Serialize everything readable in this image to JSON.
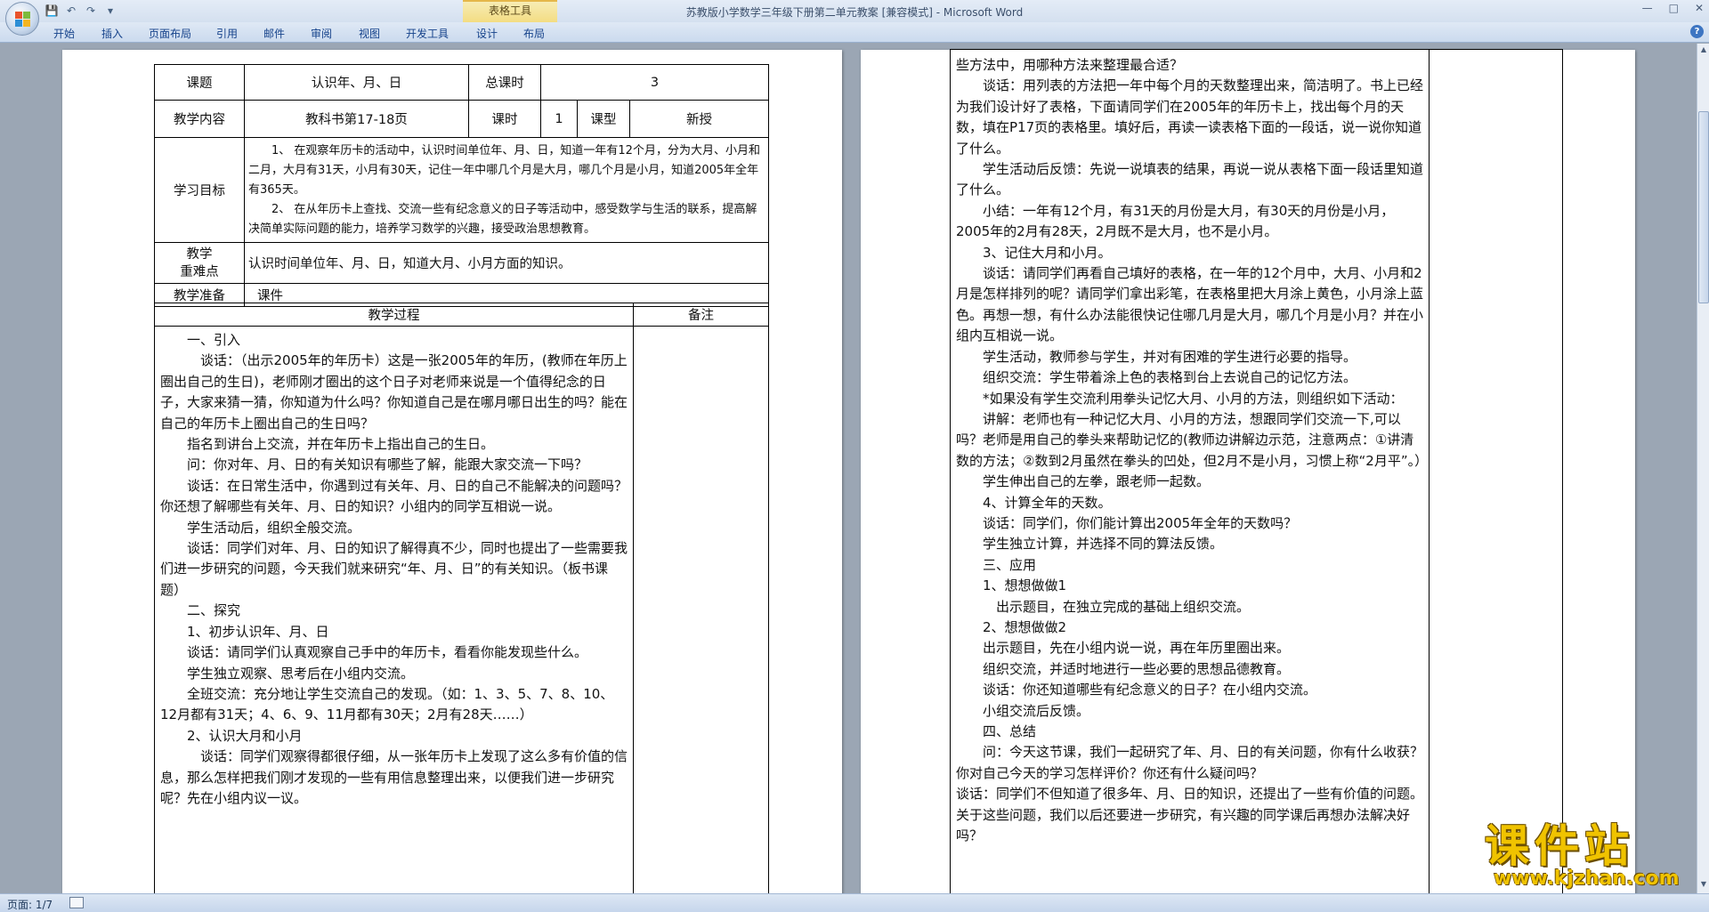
{
  "window": {
    "title": "苏教版小学数学三年级下册第二单元教案 [兼容模式] - Microsoft Word",
    "context_tab": "表格工具",
    "controls": [
      "—",
      "□",
      "✕"
    ]
  },
  "ribbon": {
    "tabs": [
      "开始",
      "插入",
      "页面布局",
      "引用",
      "邮件",
      "审阅",
      "视图",
      "开发工具",
      "设计",
      "布局"
    ]
  },
  "status": {
    "pages": "页面: 1/7"
  },
  "watermark": {
    "main": "课件站",
    "url": "www.kjzhan.com"
  },
  "page1": {
    "row1": {
      "topic_label": "课题",
      "topic": "认识年、月、日",
      "total_label": "总课时",
      "total": "3"
    },
    "row2": {
      "content_label": "教学内容",
      "content": "教科书第17-18页",
      "hours_label": "课时",
      "hours": "1",
      "type_label": "课型",
      "type": "新授"
    },
    "goals": {
      "label": "学习目标",
      "items": [
        "1、 在观察年历卡的活动中，认识时间单位年、月、日，知道一年有12个月，分为大月、小月和二月，大月有31天，小月有30天，记住一年中哪几个月是大月，哪几个月是小月，知道2005年全年有365天。",
        "2、 在从年历卡上查找、交流一些有纪念意义的日子等活动中，感受数学与生活的联系，提高解决简单实际问题的能力，培养学习数学的兴趣，接受政治思想教育。"
      ]
    },
    "key_points": {
      "label_1": "教学",
      "label_2": "重难点",
      "text": "认识时间单位年、月、日，知道大月、小月方面的知识。"
    },
    "prep": {
      "label": "教学准备",
      "text": "课件"
    },
    "process_header": "教学过程",
    "notes_header": "备注",
    "process": [
      "一、引入",
      "谈话：（出示2005年的年历卡）这是一张2005年的年历，(教师在年历上圈出自己的生日)，老师刚才圈出的这个日子对老师来说是一个值得纪念的日子，大家来猜一猜，你知道为什么吗？你知道自己是在哪月哪日出生的吗？能在自己的年历卡上圈出自己的生日吗？",
      "指名到讲台上交流，并在年历卡上指出自己的生日。",
      "问：你对年、月、日的有关知识有哪些了解，能跟大家交流一下吗？",
      "谈话：在日常生活中，你遇到过有关年、月、日的自己不能解决的问题吗？你还想了解哪些有关年、月、日的知识？小组内的同学互相说一说。",
      "学生活动后，组织全般交流。",
      "谈话：同学们对年、月、日的知识了解得真不少，同时也提出了一些需要我们进一步研究的问题，今天我们就来研究“年、月、日”的有关知识。（板书课题）",
      "二、探究",
      "1、初步认识年、月、日",
      "谈话：请同学们认真观察自己手中的年历卡，看看你能发现些什么。",
      "学生独立观察、思考后在小组内交流。",
      "全班交流：充分地让学生交流自己的发现。（如：1、3、5、7、8、10、12月都有31天；4、6、9、11月都有30天；2月有28天……）",
      "2、认识大月和小月",
      "谈话：同学们观察得都很仔细，从一张年历卡上发现了这么多有价值的信息，那么怎样把我们刚才发现的一些有用信息整理出来，以便我们进一步研究呢？先在小组内议一议。"
    ]
  },
  "page2": {
    "process": [
      "些方法中，用哪种方法来整理最合适？",
      "谈话：用列表的方法把一年中每个月的天数整理出来，简洁明了。书上已经为我们设计好了表格，下面请同学们在2005年的年历卡上，找出每个月的天数，填在P17页的表格里。填好后，再读一读表格下面的一段话，说一说你知道了什么。",
      "学生活动后反馈：先说一说填表的结果，再说一说从表格下面一段话里知道了什么。",
      "小结：一年有12个月，有31天的月份是大月，有30天的月份是小月，2005年的2月有28天，2月既不是大月，也不是小月。",
      "3、记住大月和小月。",
      "谈话：请同学们再看自己填好的表格，在一年的12个月中，大月、小月和2月是怎样排列的呢？请同学们拿出彩笔，在表格里把大月涂上黄色，小月涂上蓝色。再想一想，有什么办法能很快记住哪几月是大月，哪几个月是小月？并在小组内互相说一说。",
      "学生活动，教师参与学生，并对有困难的学生进行必要的指导。",
      "组织交流：学生带着涂上色的表格到台上去说自己的记忆方法。",
      "*如果没有学生交流利用拳头记忆大月、小月的方法，则组织如下活动：",
      "讲解：老师也有一种记忆大月、小月的方法，想跟同学们交流一下,可以吗？老师是用自己的拳头来帮助记忆的(教师边讲解边示范，注意两点：①讲清数的方法；②数到2月虽然在拳头的凹处，但2月不是小月，习惯上称“2月平”。）",
      "学生伸出自己的左拳，跟老师一起数。",
      "4、计算全年的天数。",
      "谈话：同学们，你们能计算出2005年全年的天数吗？",
      "学生独立计算，并选择不同的算法反馈。",
      "三、应用",
      "1、想想做做1",
      "出示题目，在独立完成的基础上组织交流。",
      "2、想想做做2",
      "出示题目，先在小组内说一说，再在年历里圈出来。",
      "组织交流，并适时地进行一些必要的思想品德教育。",
      "谈话：你还知道哪些有纪念意义的日子？在小组内交流。",
      "小组交流后反馈。",
      "四、总结",
      "问：今天这节课，我们一起研究了年、月、日的有关问题，你有什么收获？你对自己今天的学习怎样评价？你还有什么疑问吗？",
      "谈话：同学们不但知道了很多年、月、日的知识，还提出了一些有价值的问题。关于这些问题，我们以后还要进一步研究，有兴趣的同学课后再想办法解决好吗？"
    ]
  }
}
